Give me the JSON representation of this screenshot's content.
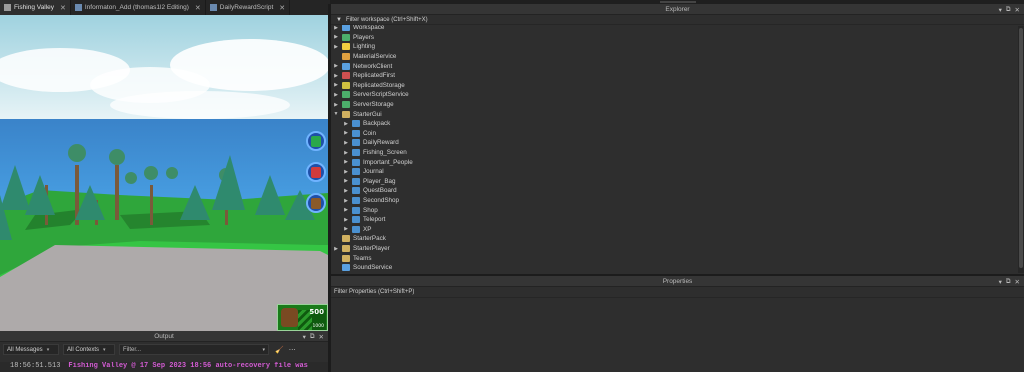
{
  "tabs": [
    {
      "label": "Fishing Valley",
      "icon": "place-icon",
      "active": true
    },
    {
      "label": "Informaton_Add (thomas1l2 Editing)",
      "icon": "script-icon",
      "active": false
    },
    {
      "label": "DailyRewardScript",
      "icon": "script-icon",
      "active": false
    }
  ],
  "viewport": {
    "bag_current": "500",
    "bag_max": "1000",
    "bag_fill": 0.5,
    "side_buttons": [
      {
        "name": "shop-button",
        "icon": "shop-icon",
        "color": "#2aa84a"
      },
      {
        "name": "teleport-button",
        "icon": "flag-icon",
        "color": "#d23b3b"
      },
      {
        "name": "journal-button",
        "icon": "book-icon",
        "color": "#8a5a2a"
      }
    ]
  },
  "output": {
    "title": "Output",
    "messages_filter": "All Messages",
    "contexts_filter": "All Contexts",
    "filter_placeholder": "Filter...",
    "log_timestamp": "18:56:51.513",
    "log_message": "Fishing Valley @ 17 Sep 2023 18:56 auto-recovery file was"
  },
  "explorer": {
    "title": "Explorer",
    "filter_placeholder": "Filter workspace (Ctrl+Shift+X)",
    "items": [
      {
        "label": "Workspace",
        "indent": 0,
        "expander": "collapsed",
        "icon": "workspace-icon",
        "color": "#5aa0e0"
      },
      {
        "label": "Players",
        "indent": 0,
        "expander": "collapsed",
        "icon": "players-icon",
        "color": "#4cae6b"
      },
      {
        "label": "Lighting",
        "indent": 0,
        "expander": "collapsed",
        "icon": "lighting-icon",
        "color": "#f0d040"
      },
      {
        "label": "MaterialService",
        "indent": 0,
        "expander": "none",
        "icon": "material-service-icon",
        "color": "#e0a040"
      },
      {
        "label": "NetworkClient",
        "indent": 0,
        "expander": "collapsed",
        "icon": "network-client-icon",
        "color": "#5aa0e0"
      },
      {
        "label": "ReplicatedFirst",
        "indent": 0,
        "expander": "collapsed",
        "icon": "replicated-first-icon",
        "color": "#d05050"
      },
      {
        "label": "ReplicatedStorage",
        "indent": 0,
        "expander": "collapsed",
        "icon": "replicated-storage-icon",
        "color": "#d0c040"
      },
      {
        "label": "ServerScriptService",
        "indent": 0,
        "expander": "collapsed",
        "icon": "server-script-service-icon",
        "color": "#4cae6b"
      },
      {
        "label": "ServerStorage",
        "indent": 0,
        "expander": "collapsed",
        "icon": "server-storage-icon",
        "color": "#4cae6b"
      },
      {
        "label": "StarterGui",
        "indent": 0,
        "expander": "expanded",
        "icon": "starter-gui-icon",
        "color": "#d0b060"
      },
      {
        "label": "Backpack",
        "indent": 1,
        "expander": "collapsed",
        "icon": "screen-gui-icon",
        "color": "#4a90d0"
      },
      {
        "label": "Coin",
        "indent": 1,
        "expander": "collapsed",
        "icon": "screen-gui-icon",
        "color": "#4a90d0"
      },
      {
        "label": "DailyReward",
        "indent": 1,
        "expander": "collapsed",
        "icon": "screen-gui-icon",
        "color": "#4a90d0"
      },
      {
        "label": "Fishing_Screen",
        "indent": 1,
        "expander": "collapsed",
        "icon": "screen-gui-icon",
        "color": "#4a90d0"
      },
      {
        "label": "Important_People",
        "indent": 1,
        "expander": "collapsed",
        "icon": "screen-gui-icon",
        "color": "#4a90d0"
      },
      {
        "label": "Journal",
        "indent": 1,
        "expander": "collapsed",
        "icon": "screen-gui-icon",
        "color": "#4a90d0"
      },
      {
        "label": "Player_Bag",
        "indent": 1,
        "expander": "collapsed",
        "icon": "screen-gui-icon",
        "color": "#4a90d0"
      },
      {
        "label": "QuestBoard",
        "indent": 1,
        "expander": "collapsed",
        "icon": "screen-gui-icon",
        "color": "#4a90d0"
      },
      {
        "label": "SecondShop",
        "indent": 1,
        "expander": "collapsed",
        "icon": "screen-gui-icon",
        "color": "#4a90d0"
      },
      {
        "label": "Shop",
        "indent": 1,
        "expander": "collapsed",
        "icon": "screen-gui-icon",
        "color": "#4a90d0"
      },
      {
        "label": "Teleport",
        "indent": 1,
        "expander": "collapsed",
        "icon": "screen-gui-icon",
        "color": "#4a90d0"
      },
      {
        "label": "XP",
        "indent": 1,
        "expander": "collapsed",
        "icon": "screen-gui-icon",
        "color": "#4a90d0"
      },
      {
        "label": "StarterPack",
        "indent": 0,
        "expander": "none",
        "icon": "starter-pack-icon",
        "color": "#d0b060"
      },
      {
        "label": "StarterPlayer",
        "indent": 0,
        "expander": "collapsed",
        "icon": "starter-player-icon",
        "color": "#d0b060"
      },
      {
        "label": "Teams",
        "indent": 0,
        "expander": "none",
        "icon": "teams-icon",
        "color": "#d0b060"
      },
      {
        "label": "SoundService",
        "indent": 0,
        "expander": "none",
        "icon": "sound-service-icon",
        "color": "#5aa0e0"
      }
    ]
  },
  "properties": {
    "title": "Properties",
    "filter_placeholder": "Filter Properties (Ctrl+Shift+P)"
  }
}
